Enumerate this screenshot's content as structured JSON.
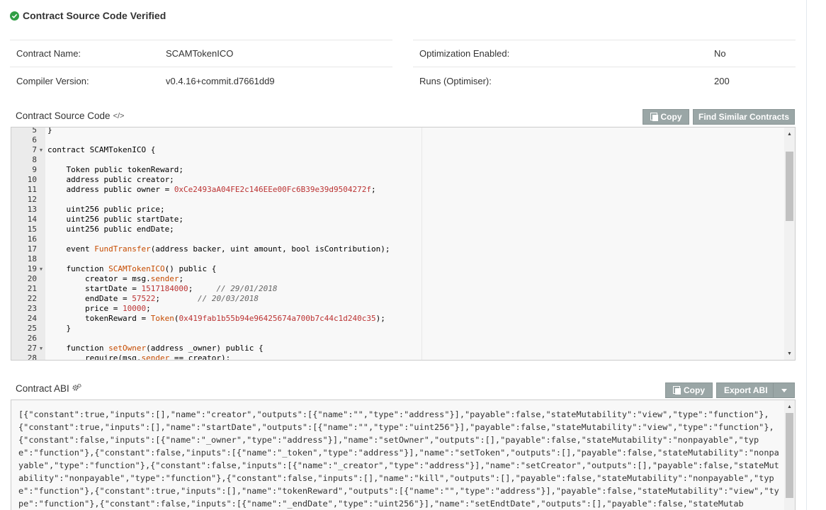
{
  "header": {
    "verified_label": "Contract Source Code Verified"
  },
  "details_left": [
    {
      "label": "Contract Name:",
      "value": "SCAMTokenICO"
    },
    {
      "label": "Compiler Version:",
      "value": "v0.4.16+commit.d7661dd9"
    }
  ],
  "details_right": [
    {
      "label": "Optimization Enabled:",
      "value": "No"
    },
    {
      "label": "Runs (Optimiser):",
      "value": "200"
    }
  ],
  "source_section": {
    "title": "Contract Source Code",
    "title_icon": "</>",
    "copy_label": "Copy",
    "similar_label": "Find Similar Contracts"
  },
  "code_lines": [
    {
      "n": "5",
      "fold": false,
      "text": "}"
    },
    {
      "n": "6",
      "fold": false,
      "text": ""
    },
    {
      "n": "7",
      "fold": true,
      "text": "contract SCAMTokenICO {"
    },
    {
      "n": "8",
      "fold": false,
      "text": ""
    },
    {
      "n": "9",
      "fold": false,
      "text": "    Token public tokenReward;"
    },
    {
      "n": "10",
      "fold": false,
      "text": "    address public creator;"
    },
    {
      "n": "11",
      "fold": false,
      "text": "    address public owner = 0xCe2493aA04FE2c146EEe00Fc6B39e39d9504272f;"
    },
    {
      "n": "12",
      "fold": false,
      "text": ""
    },
    {
      "n": "13",
      "fold": false,
      "text": "    uint256 public price;"
    },
    {
      "n": "14",
      "fold": false,
      "text": "    uint256 public startDate;"
    },
    {
      "n": "15",
      "fold": false,
      "text": "    uint256 public endDate;"
    },
    {
      "n": "16",
      "fold": false,
      "text": ""
    },
    {
      "n": "17",
      "fold": false,
      "text": "    event FundTransfer(address backer, uint amount, bool isContribution);"
    },
    {
      "n": "18",
      "fold": false,
      "text": ""
    },
    {
      "n": "19",
      "fold": true,
      "text": "    function SCAMTokenICO() public {"
    },
    {
      "n": "20",
      "fold": false,
      "text": "        creator = msg.sender;"
    },
    {
      "n": "21",
      "fold": false,
      "text": "        startDate = 1517184000;     // 29/01/2018"
    },
    {
      "n": "22",
      "fold": false,
      "text": "        endDate = 57522;        // 20/03/2018"
    },
    {
      "n": "23",
      "fold": false,
      "text": "        price = 10000;"
    },
    {
      "n": "24",
      "fold": false,
      "text": "        tokenReward = Token(0x419fab1b55b94e96425674a700b7c44c1d240c35);"
    },
    {
      "n": "25",
      "fold": false,
      "text": "    }"
    },
    {
      "n": "26",
      "fold": false,
      "text": ""
    },
    {
      "n": "27",
      "fold": true,
      "text": "    function setOwner(address _owner) public {"
    },
    {
      "n": "28",
      "fold": false,
      "text": "        require(msg.sender == creator);"
    }
  ],
  "abi_section": {
    "title": "Contract ABI",
    "copy_label": "Copy",
    "export_label": "Export ABI",
    "text": "[{\"constant\":true,\"inputs\":[],\"name\":\"creator\",\"outputs\":[{\"name\":\"\",\"type\":\"address\"}],\"payable\":false,\"stateMutability\":\"view\",\"type\":\"function\"},{\"constant\":true,\"inputs\":[],\"name\":\"startDate\",\"outputs\":[{\"name\":\"\",\"type\":\"uint256\"}],\"payable\":false,\"stateMutability\":\"view\",\"type\":\"function\"},{\"constant\":false,\"inputs\":[{\"name\":\"_owner\",\"type\":\"address\"}],\"name\":\"setOwner\",\"outputs\":[],\"payable\":false,\"stateMutability\":\"nonpayable\",\"type\":\"function\"},{\"constant\":false,\"inputs\":[{\"name\":\"_token\",\"type\":\"address\"}],\"name\":\"setToken\",\"outputs\":[],\"payable\":false,\"stateMutability\":\"nonpayable\",\"type\":\"function\"},{\"constant\":false,\"inputs\":[{\"name\":\"_creator\",\"type\":\"address\"}],\"name\":\"setCreator\",\"outputs\":[],\"payable\":false,\"stateMutability\":\"nonpayable\",\"type\":\"function\"},{\"constant\":false,\"inputs\":[],\"name\":\"kill\",\"outputs\":[],\"payable\":false,\"stateMutability\":\"nonpayable\",\"type\":\"function\"},{\"constant\":true,\"inputs\":[],\"name\":\"tokenReward\",\"outputs\":[{\"name\":\"\",\"type\":\"address\"}],\"payable\":false,\"stateMutability\":\"view\",\"type\":\"function\"},{\"constant\":false,\"inputs\":[{\"name\":\"_endDate\",\"type\":\"uint256\"}],\"name\":\"setEndtDate\",\"outputs\":[],\"payable\":false,\"stateMutab"
  },
  "colors": {
    "verified_green": "#2f9e44",
    "button_gray": "#9aa6a6",
    "function_name": "#c64b00"
  }
}
